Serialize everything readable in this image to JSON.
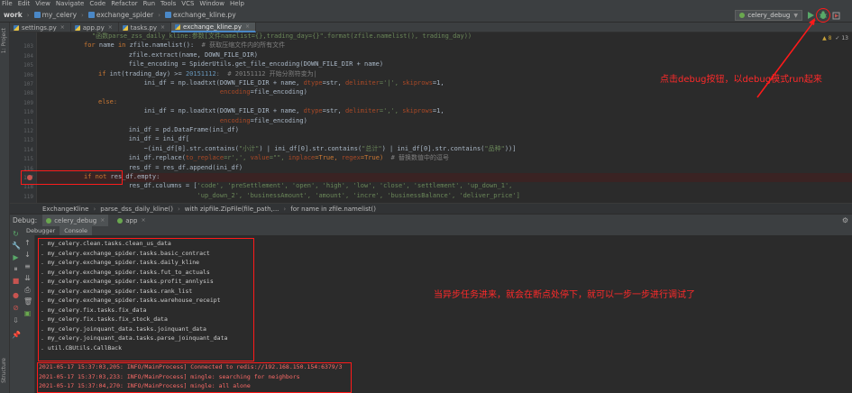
{
  "menu": [
    "File",
    "Edit",
    "View",
    "Navigate",
    "Code",
    "Refactor",
    "Run",
    "Tools",
    "VCS",
    "Window",
    "Help"
  ],
  "nav": {
    "root": "work",
    "crumbs": [
      "my_celery",
      "exchange_spider",
      "exchange_kline.py"
    ]
  },
  "run_config": "celery_debug",
  "side_labels": {
    "project": "1: Project",
    "structure": "Structure"
  },
  "tabs": [
    {
      "label": "settings.py",
      "active": false
    },
    {
      "label": "app.py",
      "active": false
    },
    {
      "label": "tasks.py",
      "active": false
    },
    {
      "label": "exchange_kline.py",
      "active": true
    }
  ],
  "inspections": {
    "warnings": "▲ 8",
    "weak": "✓ 13"
  },
  "code": {
    "line_numbers": [
      "",
      "103",
      "104",
      "105",
      "106",
      "107",
      "108",
      "109",
      "110",
      "111",
      "112",
      "113",
      "114",
      "115",
      "116",
      "117",
      "118",
      "119"
    ],
    "line_102": "    \"函数parse_zss_daily_kline:参数[文件namelist={},trading_day={}\".format(zfile.namelist(), trading_day))",
    "line_103a": "for ",
    "line_103b": "name ",
    "line_103c": "in ",
    "line_103d": "zfile.namelist():  ",
    "line_103e": "# 获取压缩文件内的所有文件",
    "line_104": "        zfile.extract(name, DOWN_FILE_DIR)",
    "line_105": "        file_encoding = SpiderUtils.get_file_encoding(DOWN_FILE_DIR + name)",
    "line_106a": "if ",
    "line_106b": "int(trading_day) >= ",
    "line_106c": "20151112",
    "line_106d": ":  # 20151112 开始分割符变为|",
    "line_107a": "            ini_df = np.loadtxt(DOWN_FILE_DIR + name, ",
    "line_107b": "dtype",
    "line_107c": "=str, ",
    "line_107d": "delimiter",
    "line_107e": "='|', ",
    "line_107f": "skiprows",
    "line_107g": "=1,",
    "line_108a": "                                ",
    "line_108b": "encoding",
    "line_108c": "=file_encoding)",
    "line_109": "else:",
    "line_110a": "            ini_df = np.loadtxt(DOWN_FILE_DIR + name, ",
    "line_110b": "dtype",
    "line_110c": "=str, ",
    "line_110d": "delimiter",
    "line_110e": "=',', ",
    "line_110f": "skiprows",
    "line_110g": "=1,",
    "line_111a": "                                ",
    "line_111b": "encoding",
    "line_111c": "=file_encoding)",
    "line_112": "        ini_df = pd.DataFrame(ini_df)",
    "line_113": "        ini_df = ini_df[",
    "line_114a": "            ~(ini_df[0].str.contains(",
    "line_114b": "\"小计\"",
    "line_114c": ") | ini_df[0].str.contains(",
    "line_114d": "\"总计\"",
    "line_114e": ") | ini_df[0].str.contains(",
    "line_114f": "\"品种\"",
    "line_114g": "))]",
    "line_115a": "        ini_df.replace(",
    "line_115b": "to_replace",
    "line_115c": "=r',', ",
    "line_115d": "value",
    "line_115e": "=\"\", ",
    "line_115f": "inplace",
    "line_115g": "=True, ",
    "line_115h": "regex",
    "line_115i": "=True)  ",
    "line_115j": "# 替换数值中的逗号",
    "line_116": "        res_df = res_df.append(ini_df)",
    "line_117a": "if not ",
    "line_117b": "res_df.empty:",
    "line_118a": "        res_df.columns = [",
    "line_118b": "'code', 'preSettlement', 'open', 'high', 'low', 'close', 'settlement', 'up_down_1',",
    "line_119a": "                          ",
    "line_119b": "'up_down_2', 'businessAmount', 'amount', 'incre', 'businessBalance', 'deliver_price']"
  },
  "breadcrumbs": [
    "ExchangeKline",
    "parse_dss_daily_kline()",
    "with zipfile.ZipFile(file_path,...",
    "for name in zfile.namelist()"
  ],
  "debug": {
    "label": "Debug:",
    "tabs": [
      {
        "label": "celery_debug",
        "active": true
      },
      {
        "label": "app",
        "active": false
      }
    ],
    "subtabs": [
      "Debugger",
      "Console"
    ]
  },
  "console": {
    "tasks": [
      ". my_celery.clean.tasks.clean_us_data",
      ". my_celery.exchange_spider.tasks.basic_contract",
      ". my_celery.exchange_spider.tasks.daily_kline",
      ". my_celery.exchange_spider.tasks.fut_to_actuals",
      ". my_celery.exchange_spider.tasks.profit_annlysis",
      ". my_celery.exchange_spider.tasks.rank_list",
      ". my_celery.exchange_spider.tasks.warehouse_receipt",
      ". my_celery.fix.tasks.fix_data",
      ". my_celery.fix.tasks.fix_stock_data",
      ". my_celery.joinquant_data.tasks.joinquant_data",
      ". my_celery.joinquant_data.tasks.parse_joinquant_data",
      ". util.CBUtils.CallBack"
    ],
    "logs": [
      "2021-05-17 15:37:03,205: INFO/MainProcess] Connected to redis://192.168.150.154:6379/3",
      "2021-05-17 15:37:03,233: INFO/MainProcess] mingle: searching for neighbors",
      "2021-05-17 15:37:04,270: INFO/MainProcess] mingle: all alone"
    ]
  },
  "annotations": {
    "top": "点击debug按钮，以debug模式run起来",
    "bottom": "当异步任务进来，就会在断点处停下，就可以一步一步进行调试了",
    "color": "#ff1a1a"
  },
  "icons": [
    "folder-icon",
    "python-file-icon",
    "run-icon",
    "debug-icon",
    "stop-icon",
    "gear-icon",
    "breakpoint-icon",
    "bug-icon"
  ]
}
